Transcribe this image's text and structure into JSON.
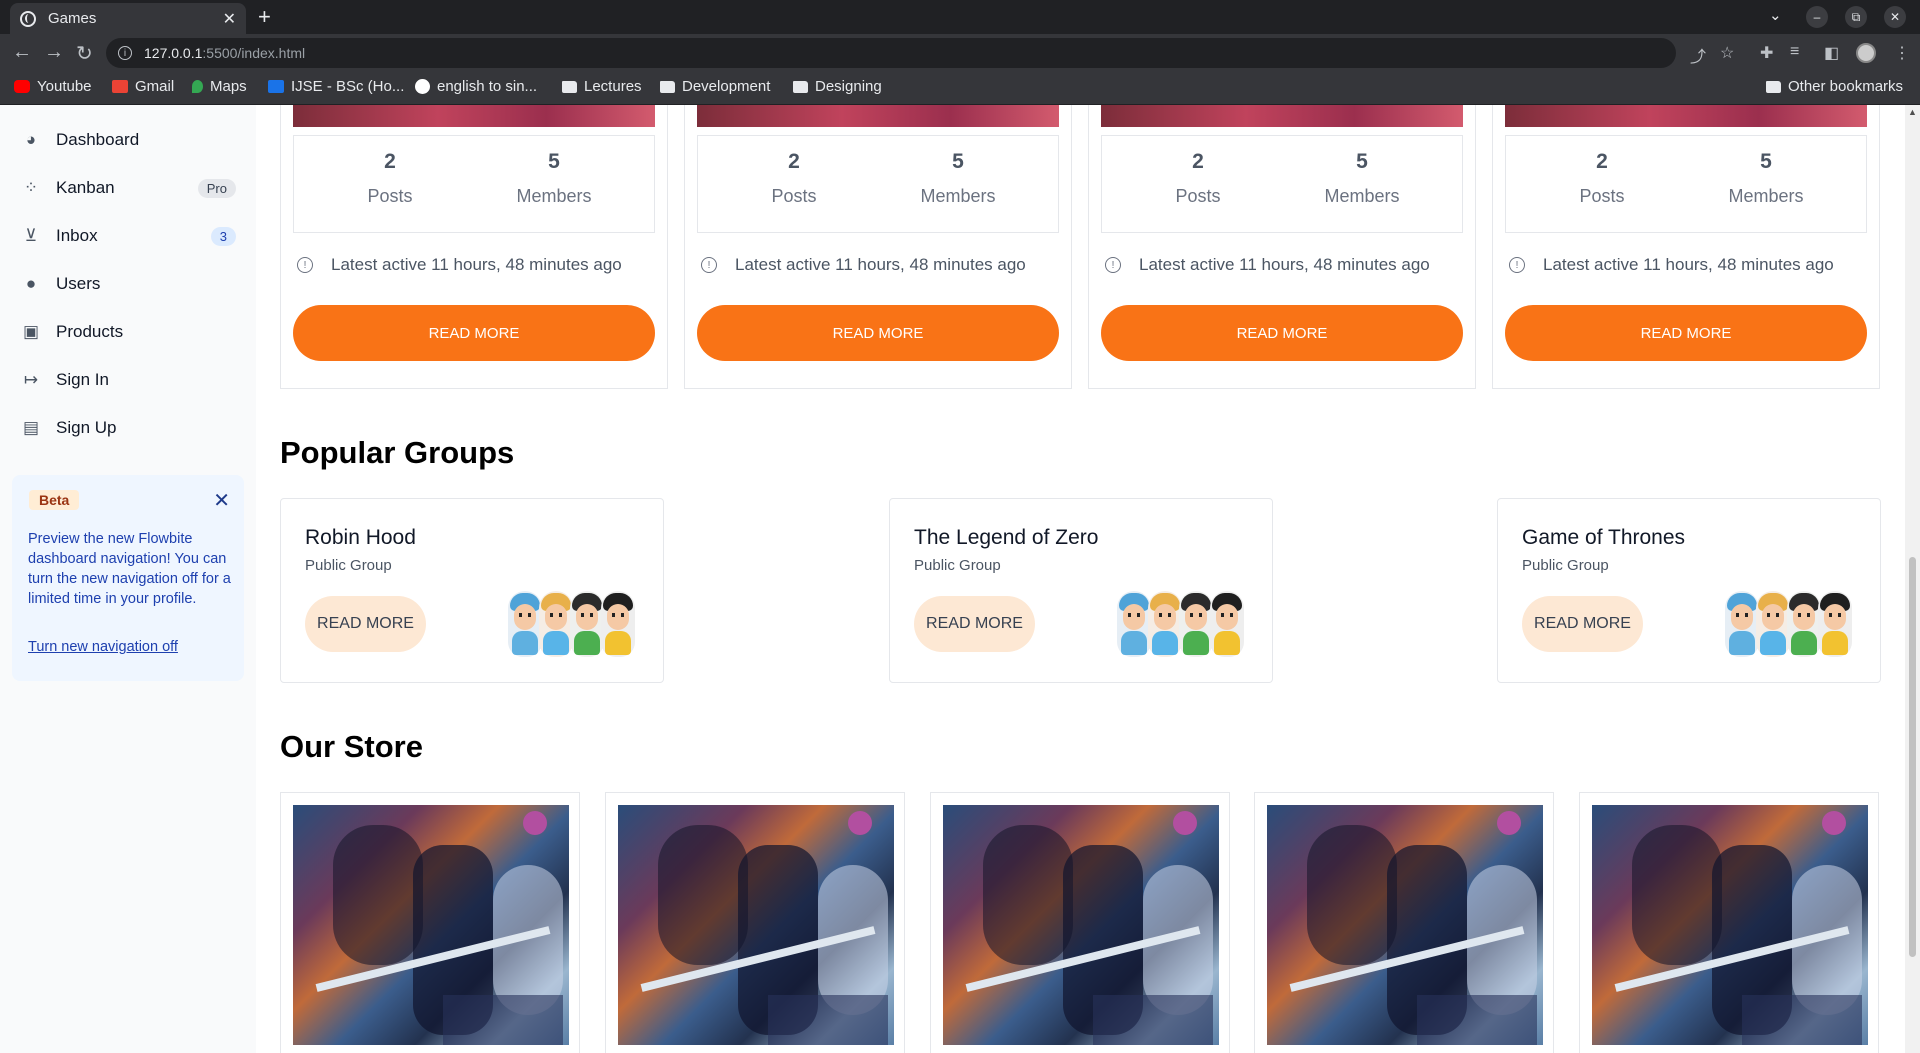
{
  "browser": {
    "tab_title": "Games",
    "tab_close": "✕",
    "new_tab": "+",
    "url_host": "127.0.0.1",
    "url_path": ":5500/index.html",
    "bookmarks": [
      {
        "label": "Youtube",
        "color": "#ff0000"
      },
      {
        "label": "Gmail",
        "color": "#ea4335"
      },
      {
        "label": "Maps",
        "color": "#34a853"
      },
      {
        "label": "IJSE - BSc (Ho...",
        "color": "#1a73e8"
      },
      {
        "label": "english to sin...",
        "color": "#ffffff"
      },
      {
        "label": "Lectures",
        "color": "#e8eaed"
      },
      {
        "label": "Development",
        "color": "#e8eaed"
      },
      {
        "label": "Designing",
        "color": "#e8eaed"
      }
    ],
    "other_bookmarks": "Other bookmarks"
  },
  "sidebar": {
    "items": [
      {
        "label": "Dashboard",
        "icon": "pie-chart-icon",
        "glyph": "◕"
      },
      {
        "label": "Kanban",
        "icon": "grid-icon",
        "glyph": "⁘",
        "badge": "Pro"
      },
      {
        "label": "Inbox",
        "icon": "inbox-icon",
        "glyph": "⊻",
        "badge": "3"
      },
      {
        "label": "Users",
        "icon": "user-icon",
        "glyph": "●"
      },
      {
        "label": "Products",
        "icon": "bag-icon",
        "glyph": "▣"
      },
      {
        "label": "Sign In",
        "icon": "sign-in-icon",
        "glyph": "↦"
      },
      {
        "label": "Sign Up",
        "icon": "table-icon",
        "glyph": "▤"
      }
    ],
    "beta": {
      "tag": "Beta",
      "close": "✕",
      "text": "Preview the new Flowbite dashboard navigation! You can turn the new navigation off for a limited time in your profile.",
      "link": "Turn new navigation off"
    }
  },
  "games": [
    {
      "posts": "2",
      "posts_label": "Posts",
      "members": "5",
      "members_label": "Members",
      "latest": "Latest active 11 hours, 48 minutes ago",
      "button": "READ MORE"
    },
    {
      "posts": "2",
      "posts_label": "Posts",
      "members": "5",
      "members_label": "Members",
      "latest": "Latest active 11 hours, 48 minutes ago",
      "button": "READ MORE"
    },
    {
      "posts": "2",
      "posts_label": "Posts",
      "members": "5",
      "members_label": "Members",
      "latest": "Latest active 11 hours, 48 minutes ago",
      "button": "READ MORE"
    },
    {
      "posts": "2",
      "posts_label": "Posts",
      "members": "5",
      "members_label": "Members",
      "latest": "Latest active 11 hours, 48 minutes ago",
      "button": "READ MORE"
    }
  ],
  "popular_groups": {
    "title": "Popular Groups",
    "groups": [
      {
        "name": "Robin Hood",
        "type": "Public Group",
        "button": "READ MORE"
      },
      {
        "name": "The Legend of Zero",
        "type": "Public Group",
        "button": "READ MORE"
      },
      {
        "name": "Game of Thrones",
        "type": "Public Group",
        "button": "READ MORE"
      }
    ]
  },
  "store": {
    "title": "Our Store",
    "item_count": 5
  },
  "colors": {
    "accent": "#f97316",
    "accent_light": "#fde8d4",
    "beta_bg": "#eff6ff",
    "beta_text": "#1e40af"
  }
}
